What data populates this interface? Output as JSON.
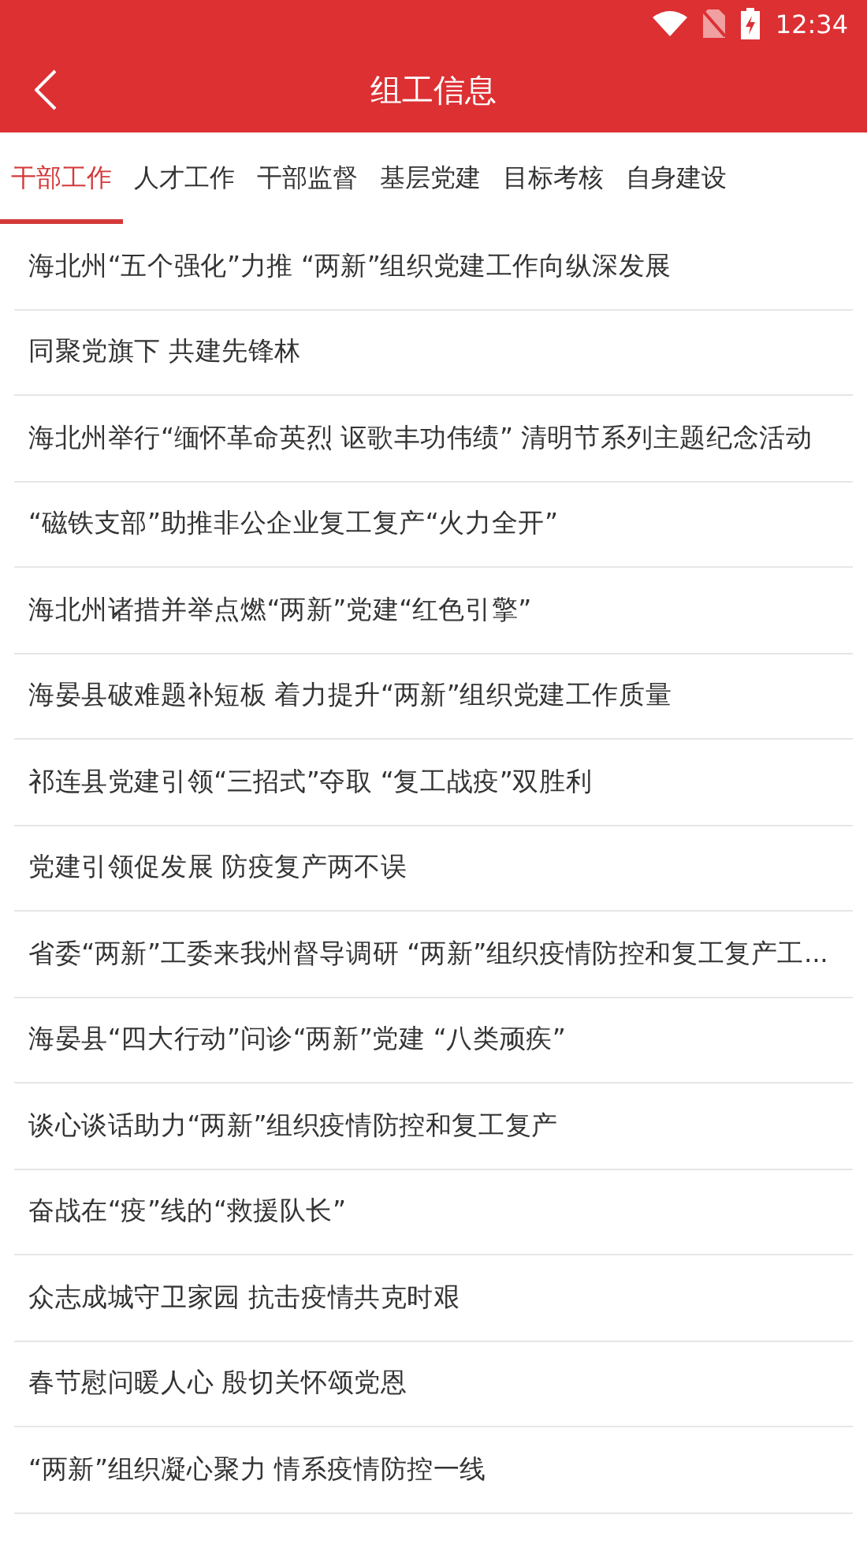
{
  "status_bar": {
    "time": "12:34"
  },
  "header": {
    "title": "组工信息"
  },
  "tabs": [
    {
      "label": "干部工作",
      "selected": true
    },
    {
      "label": "人才工作",
      "selected": false
    },
    {
      "label": "干部监督",
      "selected": false
    },
    {
      "label": "基层党建",
      "selected": false
    },
    {
      "label": "目标考核",
      "selected": false
    },
    {
      "label": "自身建设",
      "selected": false
    }
  ],
  "articles": [
    "海北州“五个强化”力推 “两新”组织党建工作向纵深发展",
    "同聚党旗下 共建先锋林",
    "海北州举行“缅怀革命英烈 讴歌丰功伟绩” 清明节系列主题纪念活动",
    "“磁铁支部”助推非公企业复工复产“火力全开”",
    "海北州诸措并举点燃“两新”党建“红色引擎”",
    "海晏县破难题补短板 着力提升“两新”组织党建工作质量",
    "祁连县党建引领“三招式”夺取 “复工战疫”双胜利",
    "党建引领促发展 防疫复产两不误",
    "省委“两新”工委来我州督导调研 “两新”组织疫情防控和复工复产工...",
    "海晏县“四大行动”问诊“两新”党建 “八类顽疾”",
    "谈心谈话助力“两新”组织疫情防控和复工复产",
    "奋战在“疫”线的“救援队长”",
    "众志成城守卫家园 抗击疫情共克时艰",
    "春节慰问暖人心 殷切关怀颂党恩",
    "“两新”组织凝心聚力 情系疫情防控一线"
  ]
}
